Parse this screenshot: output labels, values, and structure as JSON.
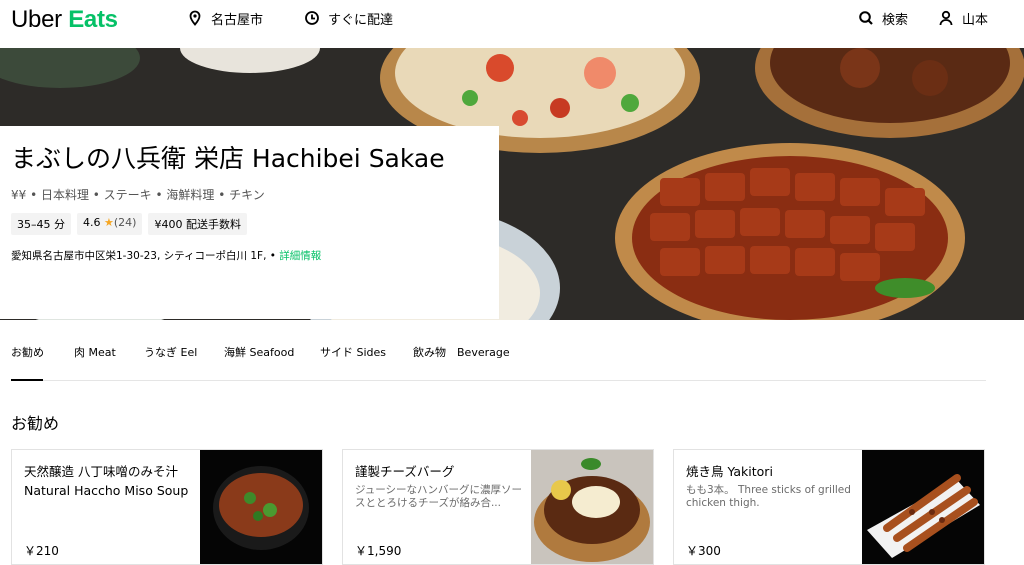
{
  "header": {
    "logo_uber": "Uber",
    "logo_eats": "Eats",
    "location": "名古屋市",
    "delivery_time": "すぐに配達",
    "search": "検索",
    "user": "山本"
  },
  "store": {
    "title": "まぶしの八兵衛 栄店 Hachibei Sakae",
    "categories": "¥¥ • 日本料理 • ステーキ • 海鮮料理 • チキン",
    "eta": "35–45 分",
    "rating": "4.6",
    "rating_count": "(24)",
    "delivery_fee": "¥400 配送手数料",
    "address": "愛知県名古屋市中区栄1-30-23, シティコーポ白川 1F, • ",
    "details_link": "詳細情報"
  },
  "tabs": [
    {
      "label": "お勧め"
    },
    {
      "label": "肉 Meat"
    },
    {
      "label": "うなぎ Eel"
    },
    {
      "label": "海鮮 Seafood"
    },
    {
      "label": "サイド Sides"
    },
    {
      "label": "飲み物　Beverage"
    }
  ],
  "section": {
    "title": "お勧め"
  },
  "items": [
    {
      "name": "天然醸造 八丁味噌のみそ汁 Natural Haccho Miso Soup",
      "description": "",
      "price": "￥210"
    },
    {
      "name": "謹製チーズバーグ",
      "description": "ジューシーなハンバーグに濃厚ソースととろけるチーズが絡み合...",
      "price": "￥1,590"
    },
    {
      "name": "焼き鳥 Yakitori",
      "description": "もも3本。 Three sticks of grilled chicken thigh.",
      "price": "￥300"
    }
  ],
  "colors": {
    "brand_green": "#06c167",
    "text": "#000000",
    "muted": "#545454"
  }
}
